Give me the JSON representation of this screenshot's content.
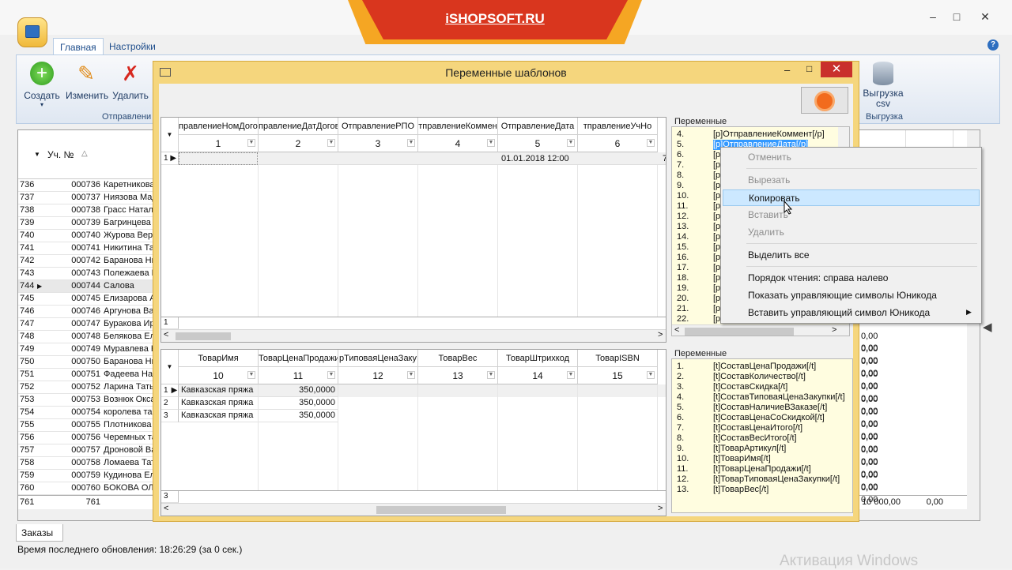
{
  "banner": {
    "text": "iSHOPSOFT.RU"
  },
  "ribbon": {
    "tabs": [
      "Главная",
      "Настройки"
    ],
    "buttons": {
      "create": "Создать",
      "edit": "Изменить",
      "delete": "Удалить"
    },
    "group_label": "Отправлени",
    "export_button": "Выгрузка csv",
    "export_group": "Выгрузка"
  },
  "bggrid": {
    "col_no": "Уч. №",
    "rows": [
      {
        "n": "736",
        "no": "000736",
        "name": "Каретникова"
      },
      {
        "n": "737",
        "no": "000737",
        "name": "Ниязова Мад"
      },
      {
        "n": "738",
        "no": "000738",
        "name": "Грасс Натал"
      },
      {
        "n": "739",
        "no": "000739",
        "name": "Багринцева"
      },
      {
        "n": "740",
        "no": "000740",
        "name": "Журова Вера"
      },
      {
        "n": "741",
        "no": "000741",
        "name": "Никитина Та"
      },
      {
        "n": "742",
        "no": "000742",
        "name": "Баранова Ни"
      },
      {
        "n": "743",
        "no": "000743",
        "name": "Полежаева В"
      },
      {
        "n": "744",
        "no": "000744",
        "name": "Салова"
      },
      {
        "n": "745",
        "no": "000745",
        "name": "Елизарова А"
      },
      {
        "n": "746",
        "no": "000746",
        "name": "Аргунова Ва"
      },
      {
        "n": "747",
        "no": "000747",
        "name": "Буракова Ир"
      },
      {
        "n": "748",
        "no": "000748",
        "name": "Белякова Ел"
      },
      {
        "n": "749",
        "no": "000749",
        "name": "Муравлева Н"
      },
      {
        "n": "750",
        "no": "000750",
        "name": "Баранова Ни"
      },
      {
        "n": "751",
        "no": "000751",
        "name": "Фадеева Нат"
      },
      {
        "n": "752",
        "no": "000752",
        "name": "Ларина Тать"
      },
      {
        "n": "753",
        "no": "000753",
        "name": "Вознюк Окса"
      },
      {
        "n": "754",
        "no": "000754",
        "name": "королева та"
      },
      {
        "n": "755",
        "no": "000755",
        "name": "Плотникова"
      },
      {
        "n": "756",
        "no": "000756",
        "name": "Черемных та"
      },
      {
        "n": "757",
        "no": "000757",
        "name": "Дроновой Ва"
      },
      {
        "n": "758",
        "no": "000758",
        "name": "Ломаева Тат"
      },
      {
        "n": "759",
        "no": "000759",
        "name": "Кудинова Ел"
      },
      {
        "n": "760",
        "no": "000760",
        "name": "БОКОВА ОЛЬ"
      }
    ],
    "total_n": "761",
    "total_no": "761",
    "right_zero": "0,00",
    "right_total": "10 000,00"
  },
  "tabs_bottom": "Заказы",
  "status": "Время последнего обновления: 18:26:29 (за 0 сек.)",
  "activation": "Активация Windows",
  "dialog": {
    "title": "Переменные шаблонов",
    "top_grid": {
      "headers": [
        "правлениеНомДогов",
        "правлениеДатДогов",
        "ОтправлениеРПО",
        "тправлениеКоммен",
        "ОтправлениеДата",
        "тправлениеУчНо"
      ],
      "numbers": [
        "1",
        "2",
        "3",
        "4",
        "5",
        "6"
      ],
      "row_label": "1",
      "date_value": "01.01.2018 12:00",
      "trailing": "7",
      "footer_row": "1"
    },
    "bottom_grid": {
      "headers": [
        "ТоварИмя",
        "ТоварЦенаПродажи",
        "рТиповаяЦенаЗаку",
        "ТоварВес",
        "ТоварШтрихкод",
        "ТоварISBN"
      ],
      "numbers": [
        "10",
        "11",
        "12",
        "13",
        "14",
        "15"
      ],
      "rows": [
        {
          "n": "1",
          "name": "Кавказская пряжа",
          "price": "350,0000"
        },
        {
          "n": "2",
          "name": "Кавказская пряжа",
          "price": "350,0000"
        },
        {
          "n": "3",
          "name": "Кавказская пряжа",
          "price": "350,0000"
        }
      ],
      "footer_row": "3"
    },
    "vars_top": {
      "label": "Переменные",
      "items": [
        {
          "n": "4.",
          "v": "[p]ОтправлениеКоммент[/p]"
        },
        {
          "n": "5.",
          "v": "[p]ОтправлениеДата[/p]"
        },
        {
          "n": "6.",
          "v": "[p"
        },
        {
          "n": "7.",
          "v": "[p"
        },
        {
          "n": "8.",
          "v": "[p"
        },
        {
          "n": "9.",
          "v": "[p"
        },
        {
          "n": "10.",
          "v": "[p"
        },
        {
          "n": "11.",
          "v": "[p"
        },
        {
          "n": "12.",
          "v": "[p"
        },
        {
          "n": "13.",
          "v": "[p"
        },
        {
          "n": "14.",
          "v": "[p"
        },
        {
          "n": "15.",
          "v": "[p"
        },
        {
          "n": "16.",
          "v": "[p"
        },
        {
          "n": "17.",
          "v": "[p"
        },
        {
          "n": "18.",
          "v": "[p"
        },
        {
          "n": "19.",
          "v": "[p"
        },
        {
          "n": "20.",
          "v": "[p"
        },
        {
          "n": "21.",
          "v": "[p"
        },
        {
          "n": "22.",
          "v": "[p"
        }
      ]
    },
    "vars_bottom": {
      "label": "Переменные",
      "items": [
        {
          "n": "1.",
          "v": "[t]СоставЦенаПродажи[/t]"
        },
        {
          "n": "2.",
          "v": "[t]СоставКоличество[/t]"
        },
        {
          "n": "3.",
          "v": "[t]СоставСкидка[/t]"
        },
        {
          "n": "4.",
          "v": "[t]СоставТиповаяЦенаЗакупки[/t]"
        },
        {
          "n": "5.",
          "v": "[t]СоставНаличиеВЗаказе[/t]"
        },
        {
          "n": "6.",
          "v": "[t]СоставЦенаСоСкидкой[/t]"
        },
        {
          "n": "7.",
          "v": "[t]СоставЦенаИтого[/t]"
        },
        {
          "n": "8.",
          "v": "[t]СоставВесИтого[/t]"
        },
        {
          "n": "9.",
          "v": "[t]ТоварАртикул[/t]"
        },
        {
          "n": "10.",
          "v": "[t]ТоварИмя[/t]"
        },
        {
          "n": "11.",
          "v": "[t]ТоварЦенаПродажи[/t]"
        },
        {
          "n": "12.",
          "v": "[t]ТоварТиповаяЦенаЗакупки[/t]"
        },
        {
          "n": "13.",
          "v": "[t]ТоварВес[/t]"
        }
      ]
    }
  },
  "context_menu": {
    "undo": "Отменить",
    "cut": "Вырезать",
    "copy": "Копировать",
    "paste": "Вставить",
    "delete": "Удалить",
    "select_all": "Выделить все",
    "rtl": "Порядок чтения: справа налево",
    "show_unicode": "Показать управляющие символы Юникода",
    "insert_unicode": "Вставить управляющий символ Юникода"
  },
  "colors": {
    "banner": "#d9361e",
    "dialog_frame": "#f5d67d",
    "close": "#c9302c",
    "var_bg": "#fffde0",
    "selection": "#3399ff"
  }
}
